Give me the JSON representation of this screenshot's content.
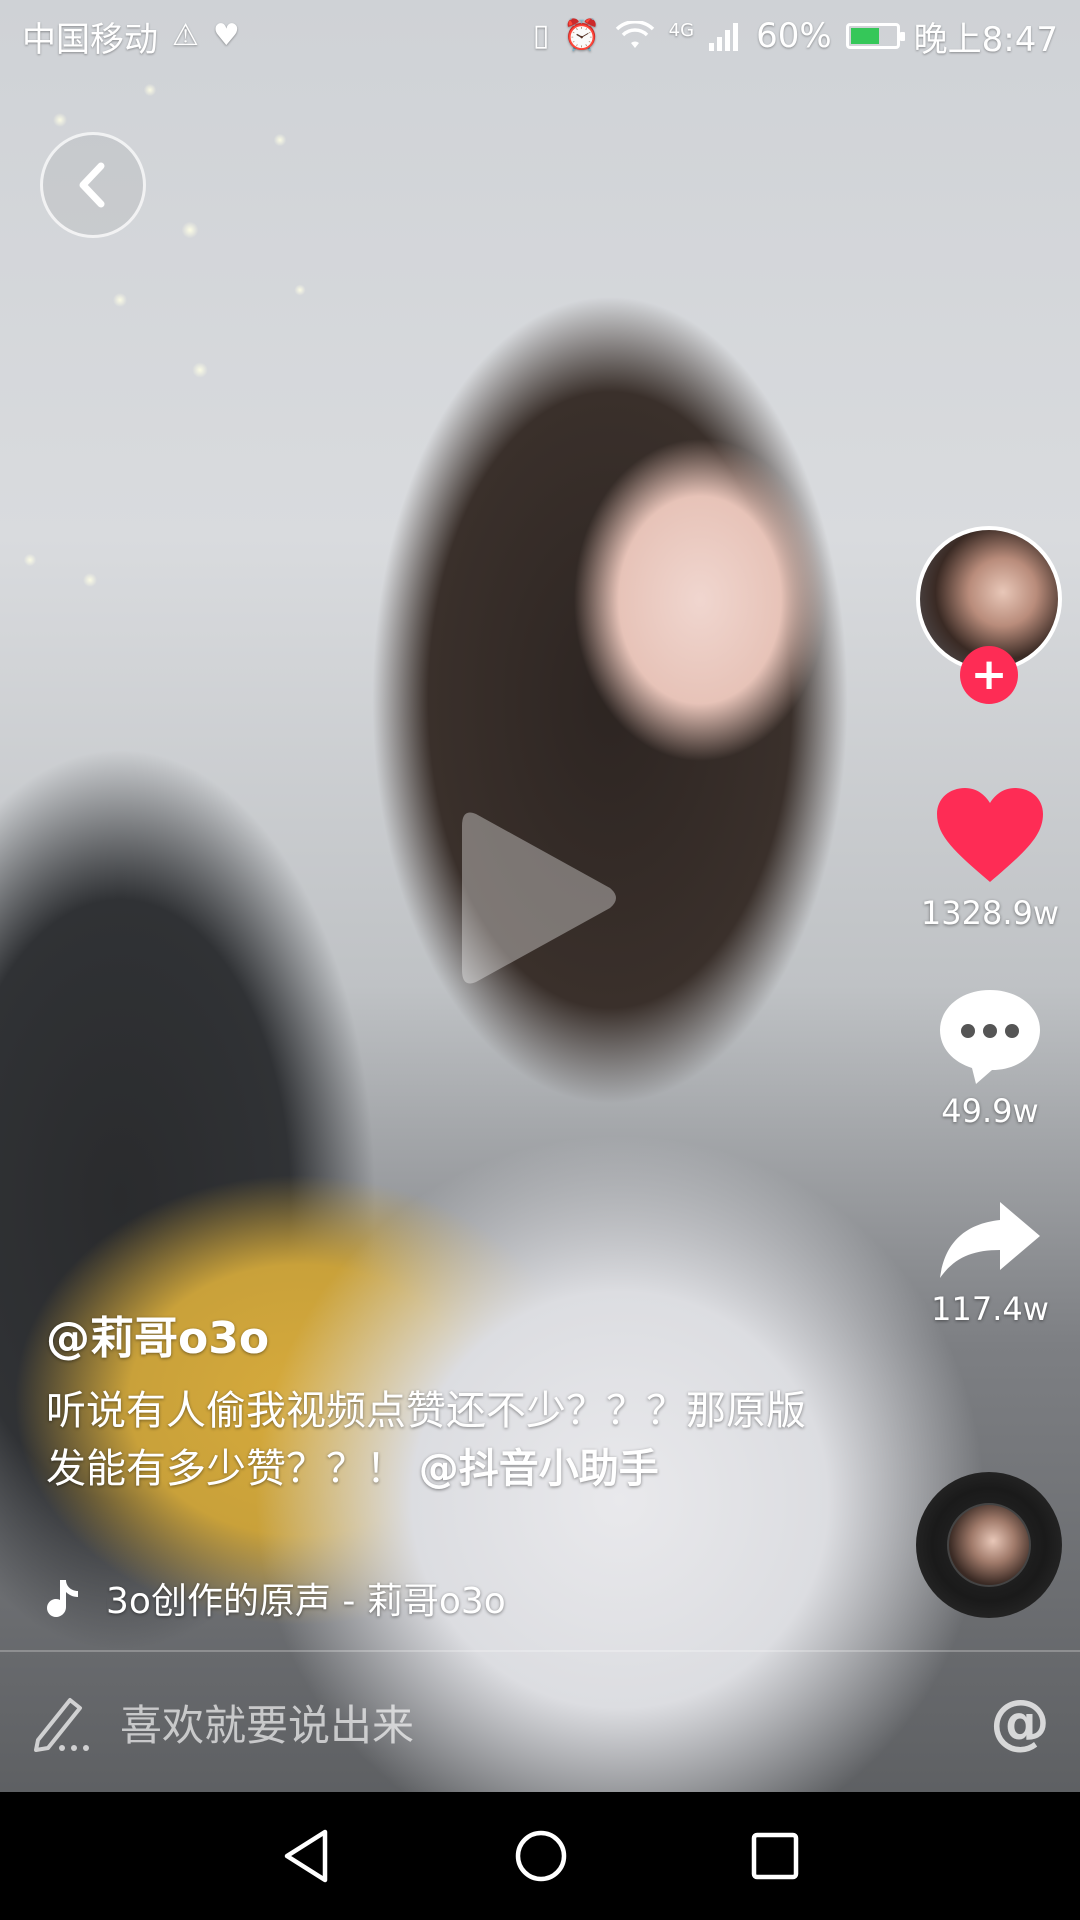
{
  "status_bar": {
    "carrier": "中国移动",
    "network": "4G",
    "battery_percent": "60%",
    "time": "晚上8:47"
  },
  "video": {
    "author": "@莉哥o3o",
    "caption_text": "听说有人偷我视频点赞还不少？？？那原版发能有多少赞？？！",
    "mention": "@抖音小助手",
    "music_title": "o3o创作的原声 - 莉哥o3o"
  },
  "actions": {
    "likes": "1328.9w",
    "comments": "49.9w",
    "shares": "117.4w"
  },
  "comment_bar": {
    "placeholder": "喜欢就要说出来",
    "at_symbol": "@"
  },
  "icons": [
    "back-icon",
    "play-icon",
    "heart-icon",
    "comment-icon",
    "share-icon",
    "music-note-icon",
    "pencil-icon",
    "nav-back-icon",
    "nav-home-icon",
    "nav-recents-icon"
  ],
  "colors": {
    "accent": "#fe2c55",
    "like": "#fe2c55",
    "battery": "#35c759"
  }
}
